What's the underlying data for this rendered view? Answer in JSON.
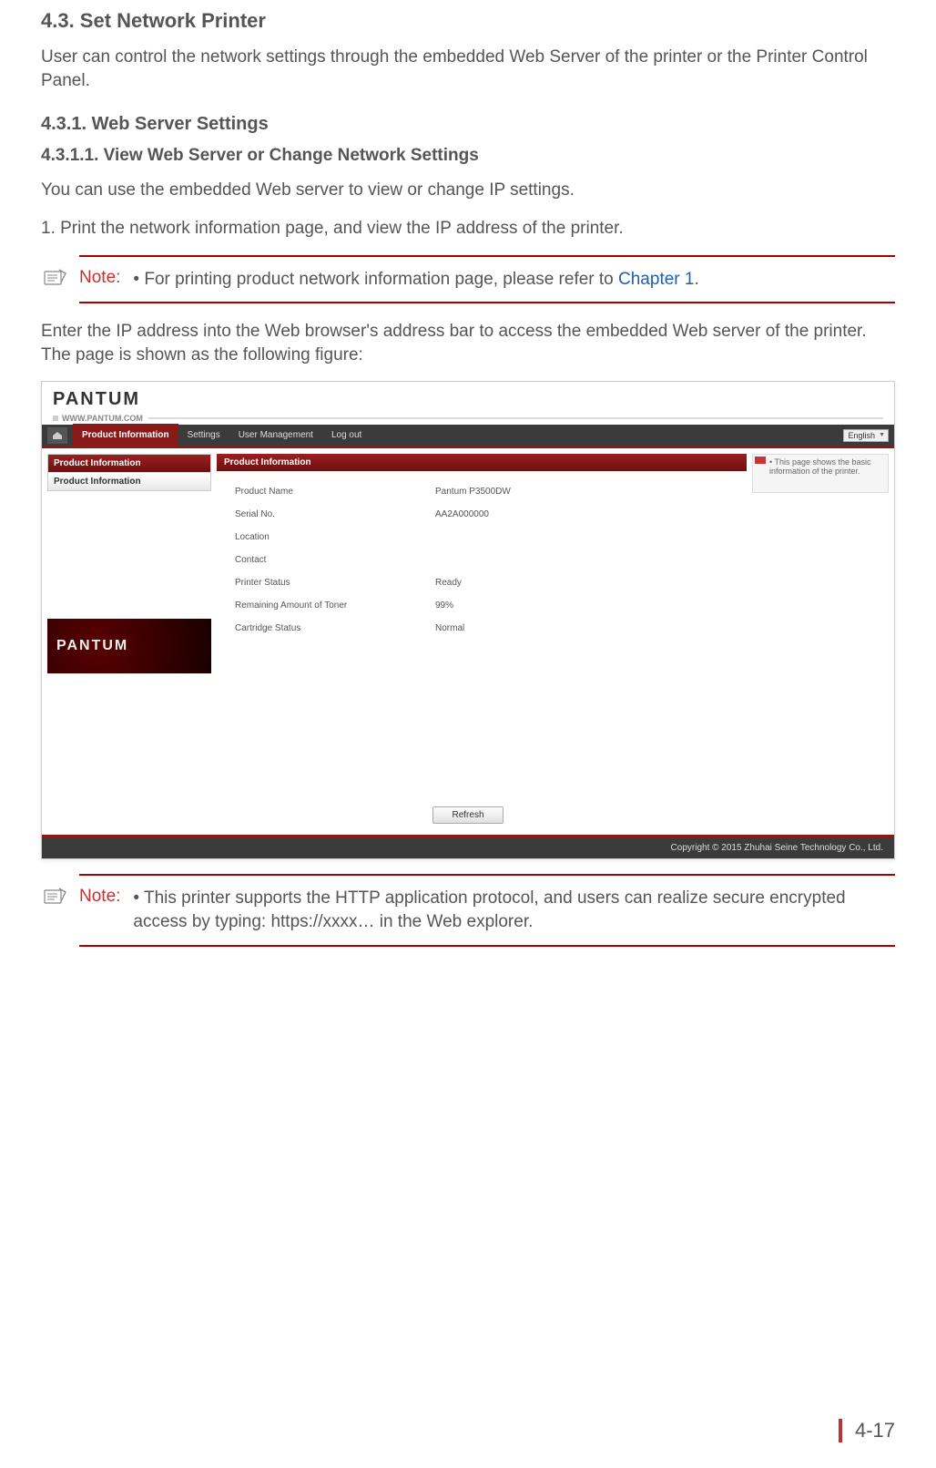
{
  "section_title": "4.3. Set Network Printer",
  "intro": "User can control the network settings through the embedded Web Server of the printer or the Printer Control Panel.",
  "sub1_title": "4.3.1. Web Server Settings",
  "sub11_title": "4.3.1.1. View Web Server or Change Network Settings",
  "p1": "You can use the embedded Web server to view or change IP settings.",
  "p2": "1. Print the network information page, and view the IP address of the printer.",
  "note1": {
    "label": "Note:",
    "text_prefix": "• For printing product network information page, please refer to ",
    "link": "Chapter 1",
    "text_suffix": "."
  },
  "p3": "Enter the IP address into the Web browser's address bar to access the embedded Web server of the printer.  The page is shown as the following figure:",
  "webshot": {
    "logo": "PANTUM",
    "url": "WWW.PANTUM.COM",
    "lang": "English",
    "tabs": [
      "Product Information",
      "Settings",
      "User Management",
      "Log out"
    ],
    "sidebar_header": "Product Information",
    "sidebar_item": "Product Information",
    "panel_header": "Product Information",
    "rows": [
      {
        "k": "Product Name",
        "v": "Pantum P3500DW"
      },
      {
        "k": "Serial No.",
        "v": "AA2A000000"
      },
      {
        "k": "Location",
        "v": ""
      },
      {
        "k": "Contact",
        "v": ""
      },
      {
        "k": "Printer Status",
        "v": "Ready"
      },
      {
        "k": "Remaining Amount of Toner",
        "v": "99%"
      },
      {
        "k": "Cartridge Status",
        "v": "Normal"
      }
    ],
    "tip": "• This page shows the basic information of the printer.",
    "promo_logo": "PANTUM",
    "refresh": "Refresh",
    "copyright": "Copyright © 2015 Zhuhai Seine Technology Co., Ltd."
  },
  "note2": {
    "label": "Note:",
    "text": "• This printer supports the HTTP application protocol, and users can realize secure encrypted access by typing: https://xxxx… in the Web explorer."
  },
  "page_number": "4-17"
}
